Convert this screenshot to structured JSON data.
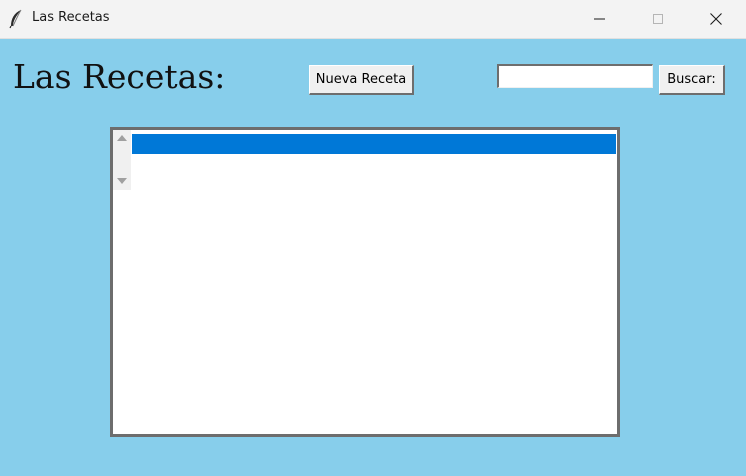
{
  "window": {
    "title": "Las Recetas",
    "background_color": "#87ceeb",
    "icon": "feather-icon",
    "controls": [
      "minimize-icon",
      "maximize-icon",
      "close-icon"
    ]
  },
  "main": {
    "heading": "Las Recetas:",
    "new_recipe_button": "Nueva Receta",
    "search": {
      "value": "",
      "button_label": "Buscar:"
    },
    "recipe_list": {
      "items": [
        ""
      ],
      "selected_index": 0,
      "selection_color": "#0078d7"
    }
  }
}
